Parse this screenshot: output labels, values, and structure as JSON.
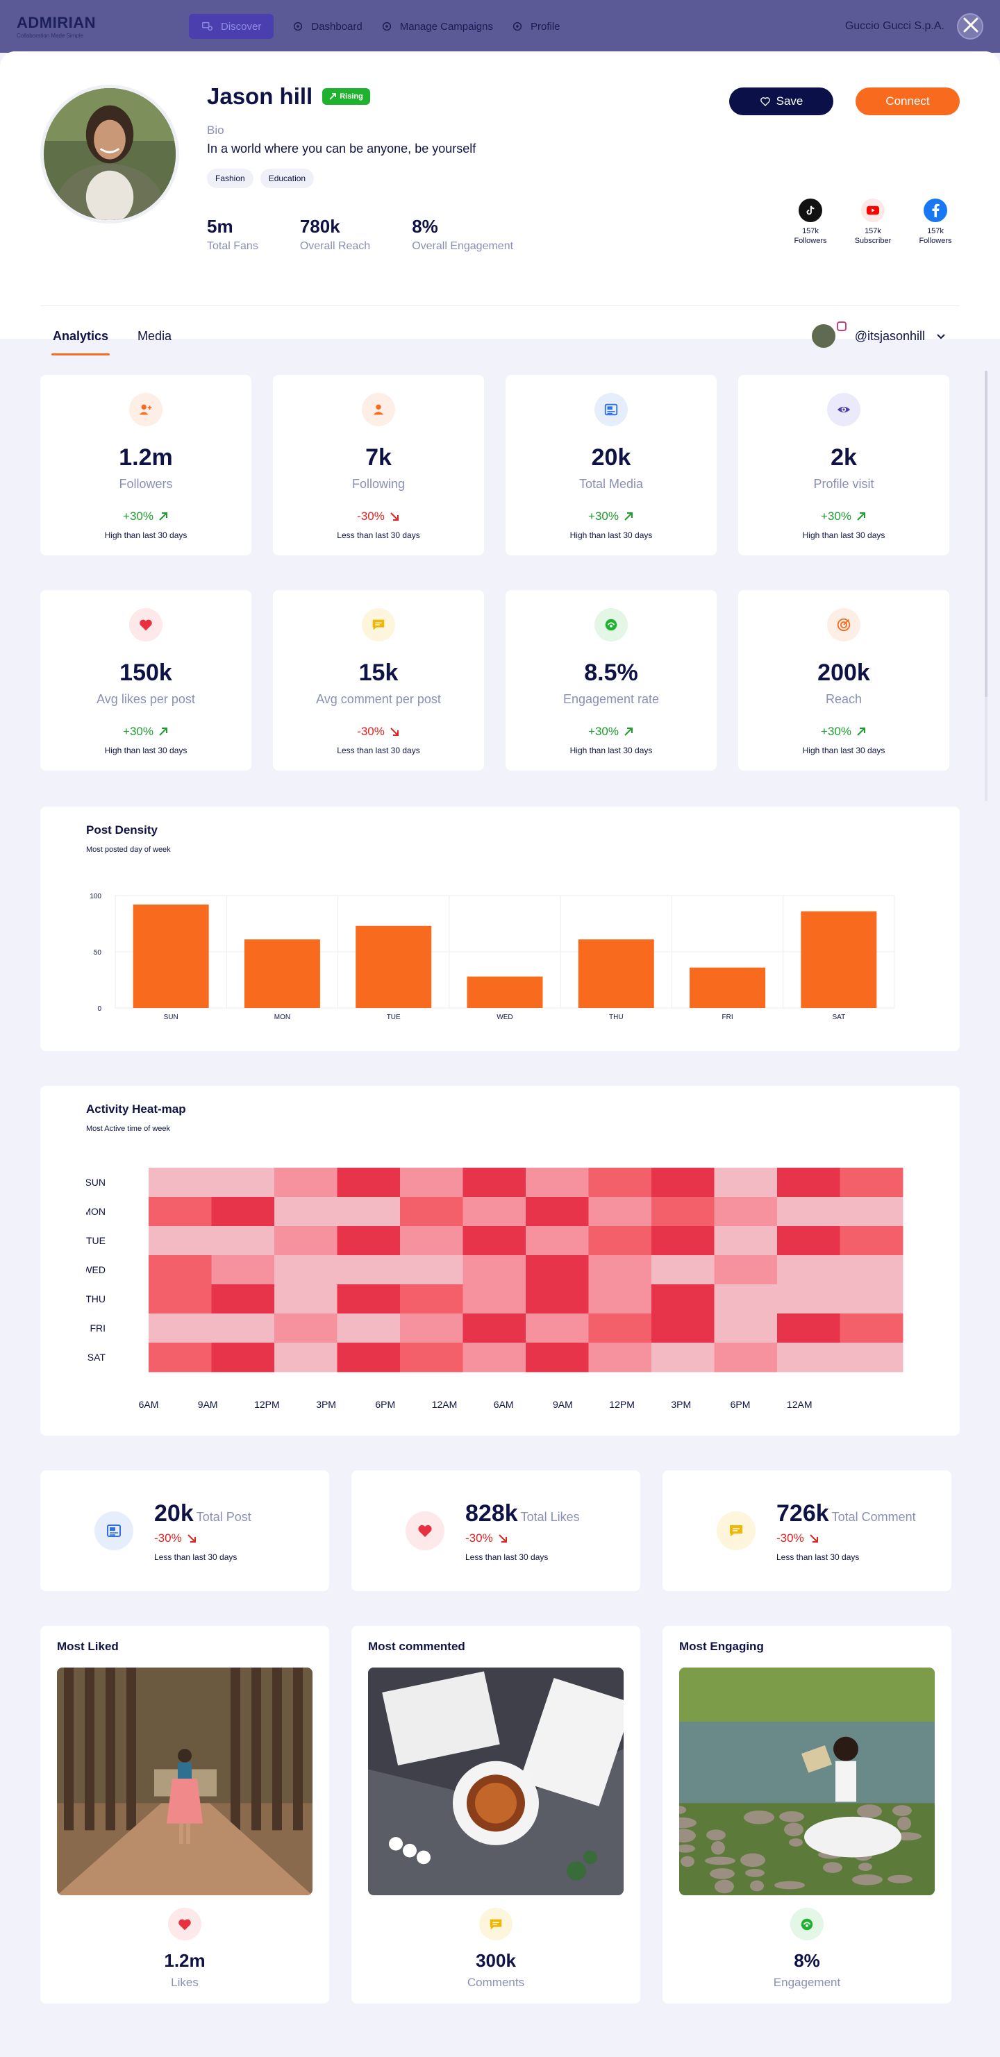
{
  "topnav": {
    "logo": "ADMIRIAN",
    "tagline": "Collaboration Made Simple",
    "items": [
      {
        "label": "Discover",
        "icon": "discover-icon"
      },
      {
        "label": "Dashboard",
        "icon": "gear-icon"
      },
      {
        "label": "Manage Campaigns",
        "icon": "gear-icon"
      },
      {
        "label": "Profile",
        "icon": "gear-icon"
      }
    ],
    "company": "Guccio Gucci S.p.A."
  },
  "profile": {
    "name": "Jason hill",
    "badge": "Rising",
    "bio_label": "Bio",
    "bio": "In a world where you can be anyone, be yourself",
    "tags": [
      "Fashion",
      "Education"
    ],
    "stats": [
      {
        "value": "5m",
        "label": "Total Fans"
      },
      {
        "value": "780k",
        "label": "Overall Reach"
      },
      {
        "value": "8%",
        "label": "Overall Engagement"
      }
    ],
    "save_label": "Save",
    "connect_label": "Connect",
    "socials": [
      {
        "platform": "tiktok-icon",
        "count": "157k",
        "label": "Followers"
      },
      {
        "platform": "youtube-icon",
        "count": "157k",
        "label": "Subscriber"
      },
      {
        "platform": "facebook-icon",
        "count": "157k",
        "label": "Followers"
      }
    ]
  },
  "tabs": [
    "Analytics",
    "Media"
  ],
  "account": "@itsjasonhill",
  "stats_row1": [
    {
      "value": "1.2m",
      "label": "Followers",
      "change": "+30%",
      "dir": "up",
      "note": "High than last 30 days",
      "icon": "user-add-icon",
      "color": "#f86a1e",
      "bg": "#fdeee6"
    },
    {
      "value": "7k",
      "label": "Following",
      "change": "-30%",
      "dir": "down",
      "note": "Less than last 30 days",
      "icon": "user-icon",
      "color": "#f86a1e",
      "bg": "#fdeee6"
    },
    {
      "value": "20k",
      "label": "Total Media",
      "change": "+30%",
      "dir": "up",
      "note": "High than last 30 days",
      "icon": "media-icon",
      "color": "#2f6fe0",
      "bg": "#e6eefc"
    },
    {
      "value": "2k",
      "label": "Profile visit",
      "change": "+30%",
      "dir": "up",
      "note": "High than last 30 days",
      "icon": "eye-icon",
      "color": "#4b3fb0",
      "bg": "#ebeafa"
    }
  ],
  "stats_row2": [
    {
      "value": "150k",
      "label": "Avg likes per post",
      "change": "+30%",
      "dir": "up",
      "note": "High than last 30 days",
      "icon": "heart-icon",
      "color": "#e8303f",
      "bg": "#fde8ea"
    },
    {
      "value": "15k",
      "label": "Avg comment per post",
      "change": "-30%",
      "dir": "down",
      "note": "Less than last 30 days",
      "icon": "comment-icon",
      "color": "#f2b705",
      "bg": "#fdf5dc"
    },
    {
      "value": "8.5%",
      "label": "Engagement rate",
      "change": "+30%",
      "dir": "up",
      "note": "High than last 30 days",
      "icon": "engagement-icon",
      "color": "#1fb22f",
      "bg": "#e4f6e6"
    },
    {
      "value": "200k",
      "label": "Reach",
      "change": "+30%",
      "dir": "up",
      "note": "High than last 30 days",
      "icon": "target-icon",
      "color": "#f86a1e",
      "bg": "#fdeee6"
    }
  ],
  "density": {
    "title": "Post Density",
    "subtitle": "Most posted day of week"
  },
  "heatmap": {
    "title": "Activity Heat-map",
    "subtitle": "Most Active time of week"
  },
  "chart_data": [
    {
      "type": "bar",
      "title": "Post Density",
      "subtitle": "Most posted day of week",
      "categories": [
        "SUN",
        "MON",
        "TUE",
        "WED",
        "THU",
        "FRI",
        "SAT"
      ],
      "values": [
        92,
        61,
        73,
        28,
        61,
        36,
        86
      ],
      "yticks": [
        0,
        50,
        100
      ],
      "ylim": [
        0,
        100
      ],
      "color": "#f86a1e",
      "grid": true
    },
    {
      "type": "heatmap",
      "title": "Activity Heat-map",
      "subtitle": "Most Active time of week",
      "rows": [
        "SUN",
        "MON",
        "TUE",
        "WED",
        "THU",
        "FRI",
        "SAT"
      ],
      "columns": [
        "6AM",
        "9AM",
        "12PM",
        "3PM",
        "6PM",
        "12AM",
        "6AM",
        "9AM",
        "12PM",
        "3PM",
        "6PM",
        "12AM"
      ],
      "levels": [
        [
          1,
          1,
          2,
          4,
          2,
          4,
          2,
          3,
          4,
          1,
          4,
          3
        ],
        [
          3,
          4,
          1,
          1,
          3,
          2,
          4,
          2,
          3,
          2,
          1,
          1
        ],
        [
          1,
          1,
          2,
          4,
          2,
          4,
          2,
          3,
          4,
          1,
          4,
          3
        ],
        [
          3,
          2,
          1,
          1,
          1,
          2,
          4,
          2,
          1,
          2,
          1,
          1
        ],
        [
          3,
          4,
          1,
          4,
          3,
          2,
          4,
          2,
          4,
          1,
          1,
          1
        ],
        [
          1,
          1,
          2,
          1,
          2,
          4,
          2,
          3,
          4,
          1,
          4,
          3
        ],
        [
          3,
          4,
          1,
          4,
          3,
          2,
          4,
          2,
          1,
          2,
          1,
          1
        ]
      ],
      "level_colors": [
        "#f6bcc6",
        "#f4bac4",
        "#f6919e",
        "#f4606a",
        "#e8344a"
      ],
      "grid": false
    }
  ],
  "totals": [
    {
      "value": "20k",
      "label": "Total Post",
      "change": "-30%",
      "note": "Less than last 30 days",
      "icon": "media-icon",
      "color": "#2f6fe0",
      "bg": "#e6eefc"
    },
    {
      "value": "828k",
      "label": "Total Likes",
      "change": "-30%",
      "note": "Less than last 30 days",
      "icon": "heart-icon",
      "color": "#e8303f",
      "bg": "#fde8ea"
    },
    {
      "value": "726k",
      "label": "Total Comment",
      "change": "-30%",
      "note": "Less than last 30 days",
      "icon": "comment-icon",
      "color": "#f2b705",
      "bg": "#fdf5dc"
    }
  ],
  "posts": [
    {
      "title": "Most Liked",
      "value": "1.2m",
      "label": "Likes",
      "icon": "heart-icon",
      "color": "#e8303f",
      "bg": "#fde8ea",
      "image": "forest-path-photo"
    },
    {
      "title": "Most commented",
      "value": "300k",
      "label": "Comments",
      "icon": "comment-icon",
      "color": "#f2b705",
      "bg": "#fdf5dc",
      "image": "coffee-books-photo"
    },
    {
      "title": "Most Engaging",
      "value": "8%",
      "label": "Engagement",
      "icon": "engagement-icon",
      "color": "#1fb22f",
      "bg": "#e4f6e6",
      "image": "reading-river-photo"
    }
  ]
}
